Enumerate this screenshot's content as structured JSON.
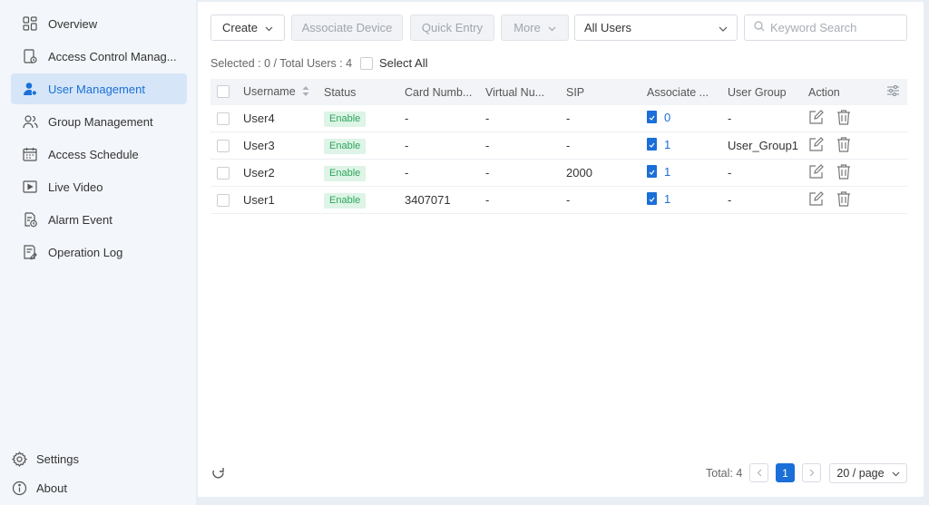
{
  "sidebar": {
    "items": [
      {
        "label": "Overview",
        "icon": "overview-icon"
      },
      {
        "label": "Access Control Manag...",
        "icon": "access-control-icon"
      },
      {
        "label": "User Management",
        "icon": "user-icon"
      },
      {
        "label": "Group Management",
        "icon": "group-icon"
      },
      {
        "label": "Access Schedule",
        "icon": "calendar-icon"
      },
      {
        "label": "Live Video",
        "icon": "video-icon"
      },
      {
        "label": "Alarm Event",
        "icon": "alarm-icon"
      },
      {
        "label": "Operation Log",
        "icon": "log-icon"
      }
    ],
    "active_item": "User Management",
    "settings_label": "Settings",
    "about_label": "About"
  },
  "toolbar": {
    "create_label": "Create",
    "associate_device_label": "Associate Device",
    "quick_entry_label": "Quick Entry",
    "more_label": "More",
    "user_filter_value": "All Users",
    "search_placeholder": "Keyword Search"
  },
  "selection": {
    "info": "Selected : 0 / Total Users : 4",
    "select_all_label": "Select All"
  },
  "table": {
    "columns": [
      "Username",
      "Status",
      "Card Numb...",
      "Virtual Nu...",
      "SIP",
      "Associate ...",
      "User Group",
      "Action"
    ],
    "rows": [
      {
        "username": "User4",
        "status": "Enable",
        "card": "-",
        "virtual": "-",
        "sip": "-",
        "associate": "0",
        "group": "-"
      },
      {
        "username": "User3",
        "status": "Enable",
        "card": "-",
        "virtual": "-",
        "sip": "-",
        "associate": "1",
        "group": "User_Group1"
      },
      {
        "username": "User2",
        "status": "Enable",
        "card": "-",
        "virtual": "-",
        "sip": "2000",
        "associate": "1",
        "group": "-"
      },
      {
        "username": "User1",
        "status": "Enable",
        "card": "3407071",
        "virtual": "-",
        "sip": "-",
        "associate": "1",
        "group": "-"
      }
    ]
  },
  "pagination": {
    "total": "Total: 4",
    "current_page": "1",
    "page_size": "20 / page"
  },
  "colors": {
    "accent": "#1b6fd8",
    "active_nav_bg": "#d6e6f8",
    "enable_badge_bg": "#ddf4e6",
    "enable_badge_text": "#2fa55c"
  }
}
